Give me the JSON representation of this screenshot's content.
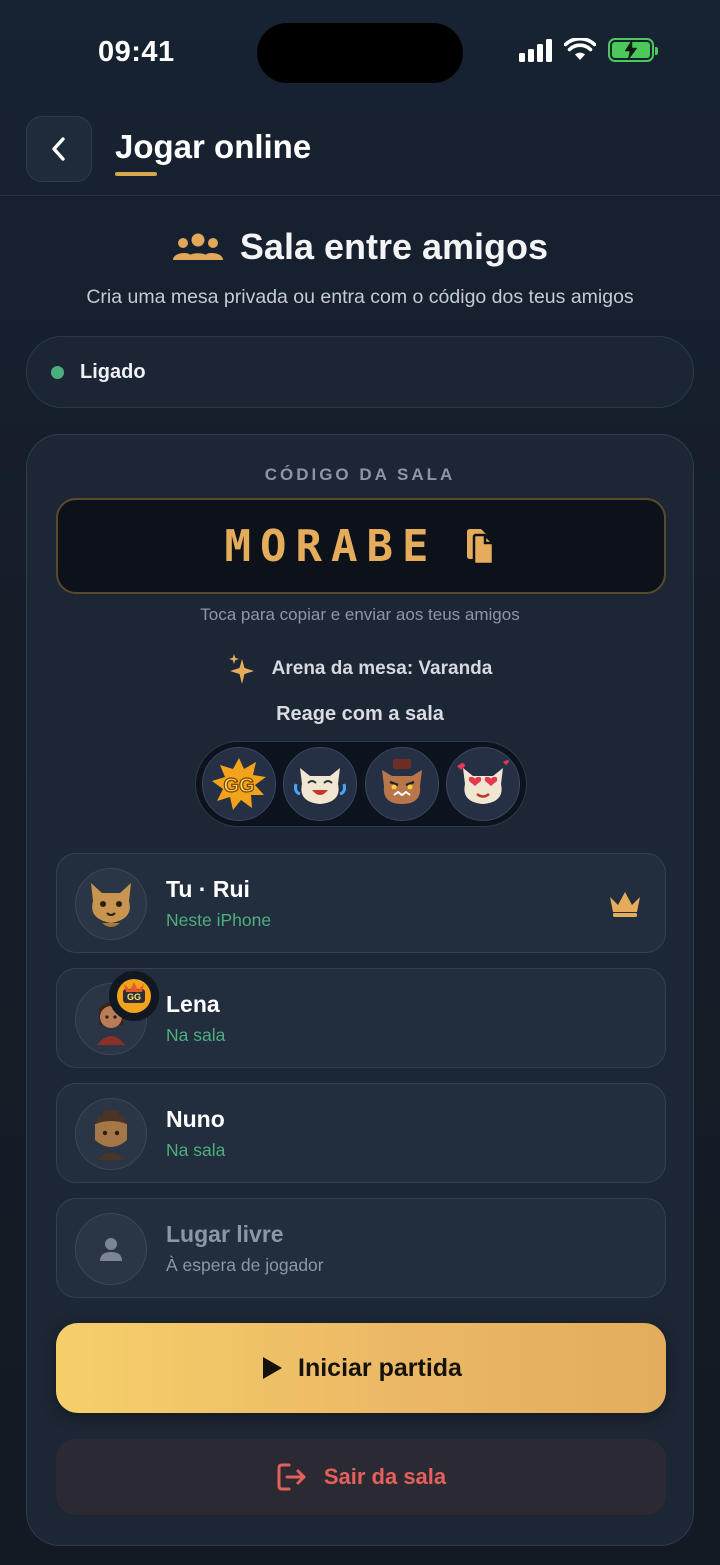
{
  "status_bar": {
    "time": "09:41"
  },
  "header": {
    "title": "Jogar online",
    "back_icon": "chevron-left-icon"
  },
  "section": {
    "icon": "group-icon",
    "title": "Sala entre amigos",
    "subtitle": "Cria uma mesa privada ou entra com o código dos teus amigos"
  },
  "connection": {
    "label": "Ligado",
    "color": "#4caf7d"
  },
  "room": {
    "code_label": "CÓDIGO DA SALA",
    "code": "MORABE",
    "copy_icon": "copy-icon",
    "code_hint": "Toca para copiar e enviar aos teus amigos",
    "arena": "Arena da mesa: Varanda",
    "react_title": "Reage com a sala",
    "reactions": [
      "gg-sticker",
      "laughing-cat-sticker",
      "angry-cat-sticker",
      "heart-eyes-cat-sticker"
    ]
  },
  "players": [
    {
      "name": "Tu · Rui",
      "status": "Neste iPhone",
      "host": true
    },
    {
      "name": "Lena",
      "status": "Na sala",
      "reaction": "gg-sticker"
    },
    {
      "name": "Nuno",
      "status": "Na sala"
    },
    {
      "name": "Lugar livre",
      "status": "À espera de jogador",
      "empty": true
    }
  ],
  "actions": {
    "start": "Iniciar partida",
    "leave": "Sair da sala"
  },
  "colors": {
    "accent": "#e5ad5b",
    "online": "#4caf7d",
    "danger": "#e5605d",
    "background": "#151d29"
  }
}
